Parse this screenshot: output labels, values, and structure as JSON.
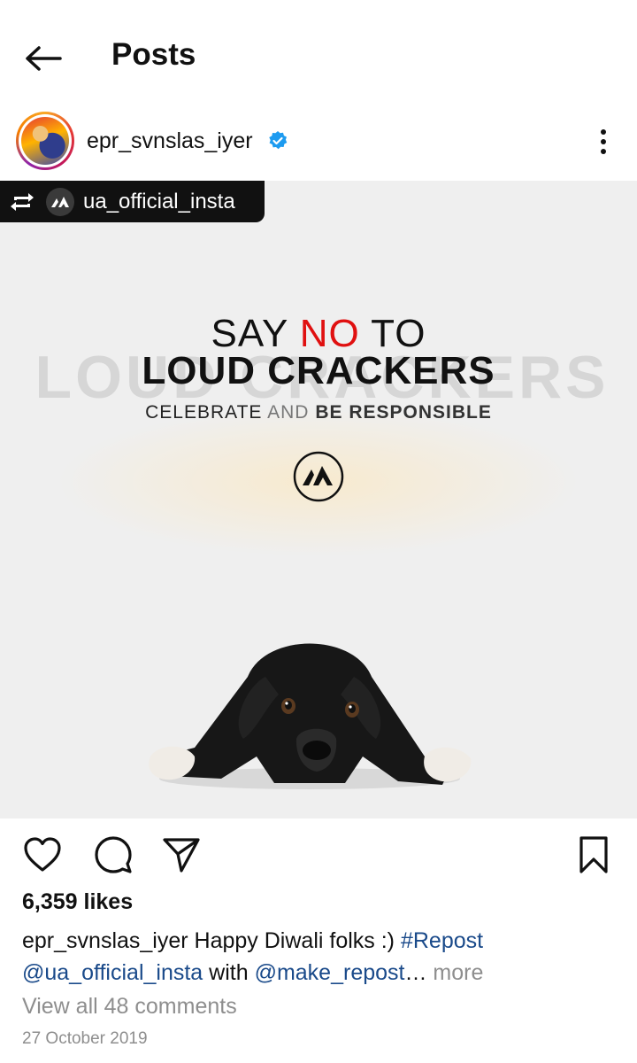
{
  "header": {
    "title": "Posts",
    "back_icon": "arrow-left-icon"
  },
  "post": {
    "username": "epr_svnslas_iyer",
    "verified_icon": "verified-badge-icon",
    "more_icon": "more-vertical-icon",
    "repost": {
      "icon": "repost-icon",
      "user": "ua_official_insta"
    },
    "image": {
      "line1_pre": "SAY ",
      "line1_red": "NO",
      "line1_post": " TO",
      "headline": "LOUD CRACKERS",
      "background_word": "LOUD CRACKERS",
      "subline_a": "CELEBRATE",
      "subline_b": " AND ",
      "subline_c": "BE ",
      "subline_d": "RESPONSIBLE",
      "logo": "ua-logo-icon",
      "accent_color": "#e01010"
    },
    "actions": {
      "like_icon": "heart-icon",
      "comment_icon": "comment-icon",
      "share_icon": "send-icon",
      "save_icon": "bookmark-icon"
    },
    "likes": "6,359 likes",
    "caption": {
      "user": "epr_svnslas_iyer",
      "text": " Happy Diwali folks :) ",
      "hashtag": "#Repost",
      "mention1": "@ua_official_insta",
      "with": " with ",
      "mention2": "@make_repost",
      "ellipsis": "…",
      "more": " more"
    },
    "view_comments": "View all 48 comments",
    "date": "27 October 2019"
  }
}
